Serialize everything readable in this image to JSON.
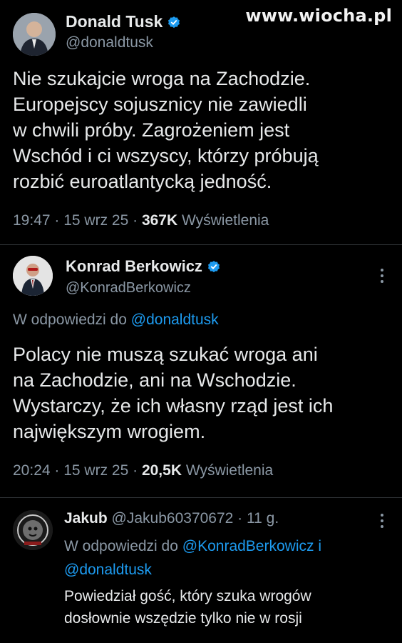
{
  "watermark": "www.wiocha.pl",
  "main_tweet": {
    "author_name": "Donald Tusk",
    "author_handle": "@donaldtusk",
    "text_lines": [
      "Nie szukajcie wroga na Zachodzie.",
      "Europejscy sojusznicy nie zawiedli",
      "w chwili próby. Zagrożeniem jest",
      "Wschód i ci wszyscy, którzy próbują",
      "rozbić euroatlantycką jedność."
    ],
    "time": "19:47",
    "date": "15 wrz 25",
    "views_count": "367K",
    "views_label": "Wyświetlenia"
  },
  "reply_1": {
    "author_name": "Konrad Berkowicz",
    "author_handle": "@KonradBerkowicz",
    "reply_prefix": "W odpowiedzi do",
    "reply_to": "@donaldtusk",
    "text_lines": [
      "Polacy nie muszą szukać wroga ani",
      "na Zachodzie, ani na Wschodzie.",
      "Wystarczy, że ich własny rząd jest ich",
      "największym wrogiem."
    ],
    "time": "20:24",
    "date": "15 wrz 25",
    "views_count": "20,5K",
    "views_label": "Wyświetlenia"
  },
  "reply_2": {
    "author_name": "Jakub",
    "author_handle": "@Jakub60370672",
    "age": "11 g.",
    "reply_prefix": "W odpowiedzi do",
    "reply_to_1": "@KonradBerkowicz",
    "reply_joiner": "i",
    "reply_to_2": "@donaldtusk",
    "text_lines": [
      "Powiedział gość, który szuka wrogów",
      "dosłownie wszędzie tylko nie w rosji"
    ]
  },
  "colors": {
    "background": "#000000",
    "text": "#e7e9ea",
    "muted": "#8b98a5",
    "link": "#1d9bf0",
    "verified": "#1d9bf0"
  },
  "icons": [
    "verified-badge-icon",
    "more-options-icon"
  ]
}
